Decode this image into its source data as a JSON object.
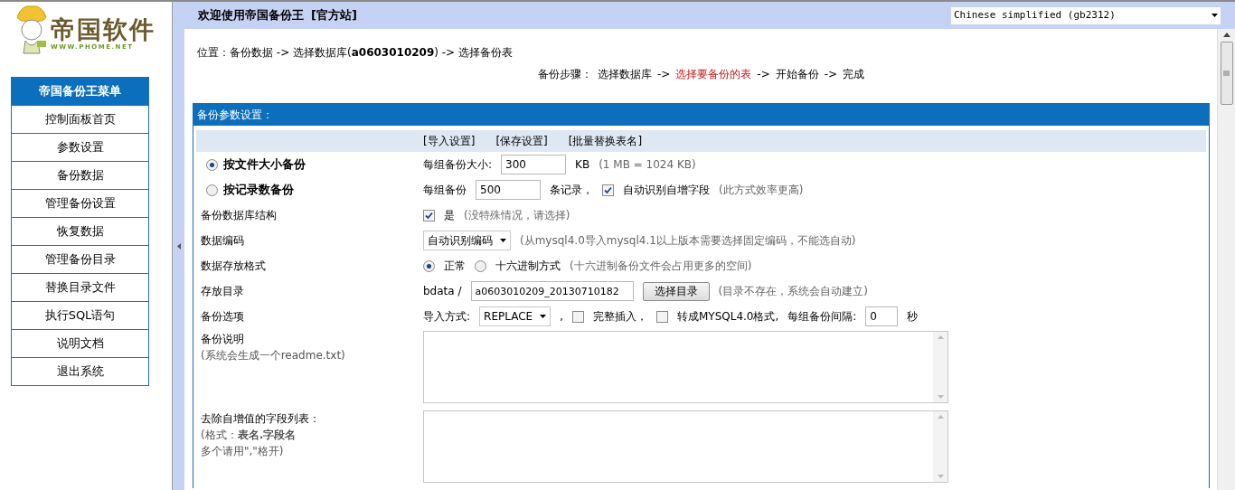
{
  "logo": {
    "title": "帝国软件",
    "url": "WWW.PHOME.NET"
  },
  "menu": {
    "title": "帝国备份王菜单",
    "items": [
      "控制面板首页",
      "参数设置",
      "备份数据",
      "管理备份设置",
      "恢复数据",
      "管理备份目录",
      "替换目录文件",
      "执行SQL语句",
      "说明文档",
      "退出系统"
    ]
  },
  "header": {
    "title": "欢迎使用帝国备份王",
    "link": "[官方站]",
    "language_select": "Chinese simplified (gb2312)"
  },
  "breadcrumb": "位置：备份数据 -> 选择数据库(**a0603010209**) -> 选择备份表",
  "steps": {
    "label": "备份步骤：",
    "items": [
      {
        "text": "选择数据库",
        "arrow": "->",
        "selected": false
      },
      {
        "text": "选择要备份的表",
        "arrow": "->",
        "selected": true
      },
      {
        "text": "开始备份",
        "arrow": "->",
        "selected": false
      },
      {
        "text": "完成",
        "selected": false
      }
    ]
  },
  "panel": {
    "title": "备份参数设置：",
    "toolbar": [
      "[导入设置]",
      "[保存设置]",
      "[批量替换表名]"
    ],
    "rows": [
      {
        "label": {
          "kind": "radio",
          "text": "按文件大小备份",
          "selected": true
        },
        "controls": [
          {
            "kind": "text",
            "text": "每组备份大小:"
          },
          {
            "kind": "input",
            "value": "300"
          },
          {
            "kind": "text",
            "text": "KB"
          },
          {
            "kind": "note",
            "text": "(1 MB = 1024 KB)"
          }
        ]
      },
      {
        "label": {
          "kind": "radio",
          "text": "按记录数备份",
          "selected": false
        },
        "controls": [
          {
            "kind": "text",
            "text": "每组备份"
          },
          {
            "kind": "input",
            "value": "500"
          },
          {
            "kind": "text",
            "text": "条记录，"
          },
          {
            "kind": "checkbox",
            "checked": true
          },
          {
            "kind": "text",
            "text": "自动识别自增字段"
          },
          {
            "kind": "note",
            "text": "(此方式效率更高)"
          }
        ]
      },
      {
        "label": {
          "kind": "plain",
          "text": "备份数据库结构"
        },
        "controls": [
          {
            "kind": "checkbox",
            "checked": true
          },
          {
            "kind": "text",
            "text": "是"
          },
          {
            "kind": "note",
            "text": "(没特殊情况，请选择)"
          }
        ]
      },
      {
        "label": {
          "kind": "plain",
          "text": "数据编码"
        },
        "controls": [
          {
            "kind": "select",
            "value": "自动识别编码"
          },
          {
            "kind": "note",
            "text": "(从mysql4.0导入mysql4.1以上版本需要选择固定编码，不能选自动)"
          }
        ]
      },
      {
        "label": {
          "kind": "plain",
          "text": "数据存放格式"
        },
        "controls": [
          {
            "kind": "radio",
            "selected": true
          },
          {
            "kind": "text",
            "text": "正常"
          },
          {
            "kind": "radio",
            "selected": false
          },
          {
            "kind": "text",
            "text": "十六进制方式"
          },
          {
            "kind": "note",
            "text": "(十六进制备份文件会占用更多的空间)"
          }
        ]
      },
      {
        "label": {
          "kind": "plain",
          "text": "存放目录"
        },
        "controls": [
          {
            "kind": "text",
            "text": "bdata /"
          },
          {
            "kind": "input",
            "value": "a0603010209_20130710182"
          },
          {
            "kind": "button",
            "text": "选择目录"
          },
          {
            "kind": "note",
            "text": "(目录不存在，系统会自动建立)"
          }
        ]
      },
      {
        "label": {
          "kind": "plain",
          "text": "备份选项"
        },
        "controls": [
          {
            "kind": "text",
            "text": "导入方式:"
          },
          {
            "kind": "select",
            "value": "REPLACE"
          },
          {
            "kind": "text",
            "text": ","
          },
          {
            "kind": "checkbox",
            "checked": false
          },
          {
            "kind": "text",
            "text": "完整插入，"
          },
          {
            "kind": "checkbox",
            "checked": false
          },
          {
            "kind": "text",
            "text": "转成MYSQL4.0格式,"
          },
          {
            "kind": "text",
            "text": "每组备份间隔:"
          },
          {
            "kind": "input",
            "value": "0"
          },
          {
            "kind": "text",
            "text": "秒"
          }
        ]
      },
      {
        "label": {
          "kind": "plain",
          "text": "备份说明",
          "sublines": [
            "(系统会生成一个readme.txt)"
          ]
        },
        "controls": [
          {
            "kind": "textarea"
          }
        ]
      },
      {
        "label": {
          "kind": "plain",
          "text": "去除自增值的字段列表：",
          "sublines": [
            "(格式：**表名.字段名**",
            "多个请用\",\"格开)"
          ]
        },
        "controls": [
          {
            "kind": "textarea"
          }
        ]
      }
    ]
  }
}
